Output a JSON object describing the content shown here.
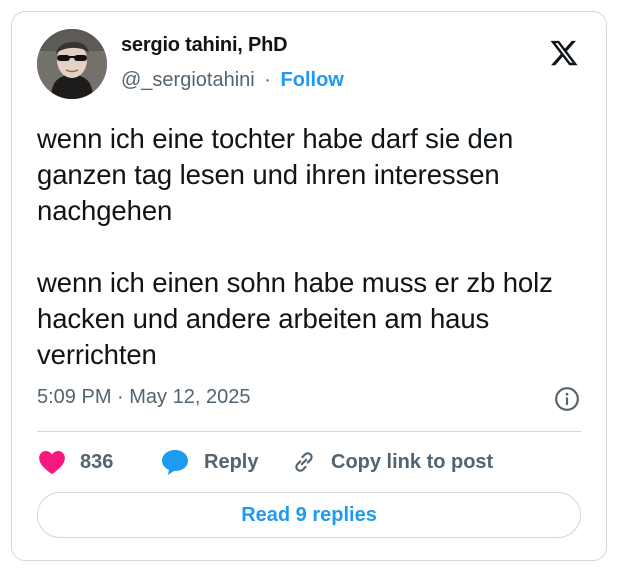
{
  "author": {
    "display_name": "sergio tahini, PhD",
    "handle": "@_sergiotahini",
    "separator": "·",
    "follow_label": "Follow"
  },
  "tweet": {
    "text": "wenn ich eine tochter habe darf sie den ganzen tag lesen und ihren interessen nachgehen\n\nwenn ich einen sohn habe muss er zb holz hacken und andere arbeiten am haus  verrichten",
    "timestamp": "5:09 PM · May 12, 2025"
  },
  "actions": {
    "like_count": "836",
    "reply_label": "Reply",
    "copy_label": "Copy link to post"
  },
  "footer": {
    "read_replies_label": "Read 9 replies"
  },
  "icons": {
    "logo": "x-logo-icon",
    "info": "info-icon",
    "like": "heart-icon",
    "reply": "speech-bubble-icon",
    "copy": "link-icon"
  },
  "colors": {
    "accent": "#1d9bf0",
    "like": "#f91880",
    "muted": "#536471",
    "border": "#cfd9de",
    "text": "#0f1419"
  }
}
